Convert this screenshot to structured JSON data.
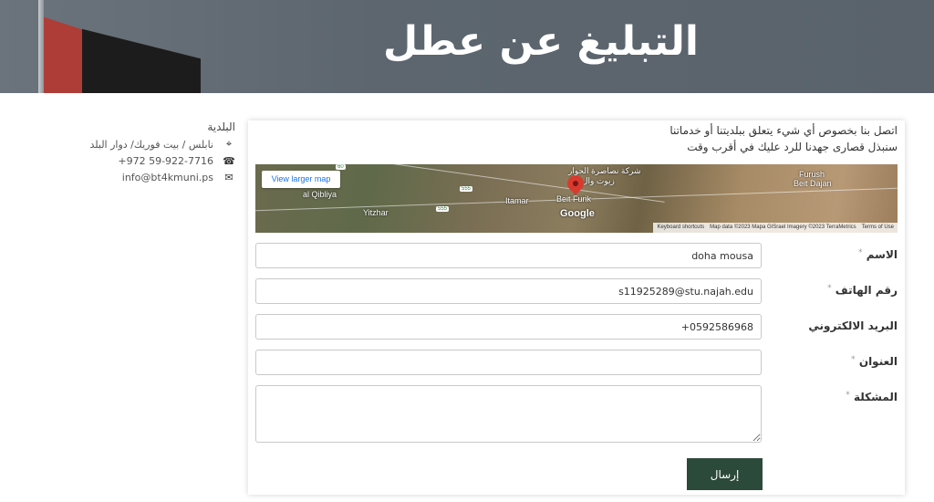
{
  "hero": {
    "title": "التبليغ عن عطل"
  },
  "sidebar": {
    "title": "البلدية",
    "items": [
      {
        "icon": "location-icon",
        "glyph": "⌖",
        "text": "نابلس / بيت فوريك/ دوار البلد"
      },
      {
        "icon": "phone-icon",
        "glyph": "☎",
        "text": "+972 59-922-7716"
      },
      {
        "icon": "envelope-icon",
        "glyph": "✉",
        "text": "info@bt4kmuni.ps"
      }
    ]
  },
  "intro": {
    "line1": "اتصل بنا بخصوص أي شيء يتعلق ببلديتنا أو خدماتنا",
    "line2": "سنبذل قصارى جهدنا للرد عليك في أقرب وقت"
  },
  "map": {
    "view_larger": "View larger map",
    "labels": {
      "qibliya": "al Qibliya",
      "yitzhar": "Yitzhar",
      "itamar": "Itamar",
      "beit_furik": "Beit Furik",
      "furush": "Furush",
      "beit_dajan": "Beit Dajan",
      "top_arabic": "شركة نصاصرة الحوار",
      "top_arabic2": "زيوت وال"
    },
    "shields": {
      "s60": "60",
      "s555a": "555",
      "s555b": "555"
    },
    "google": "Google",
    "attribution": {
      "shortcuts": "Keyboard shortcuts",
      "data": "Map data ©2023 Mapa GISrael Imagery ©2023 TerraMetrics",
      "terms": "Terms of Use"
    }
  },
  "form": {
    "name": {
      "label": "الاسم",
      "value": "doha mousa"
    },
    "phone": {
      "label": "رقم الهاتف",
      "value": "s11925289@stu.najah.edu"
    },
    "email": {
      "label": "البريد الالكتروني",
      "value": "+0592586968"
    },
    "address": {
      "label": "العنوان",
      "value": ""
    },
    "problem": {
      "label": "المشكلة",
      "value": ""
    },
    "required_mark": "*",
    "submit": "إرسال"
  }
}
